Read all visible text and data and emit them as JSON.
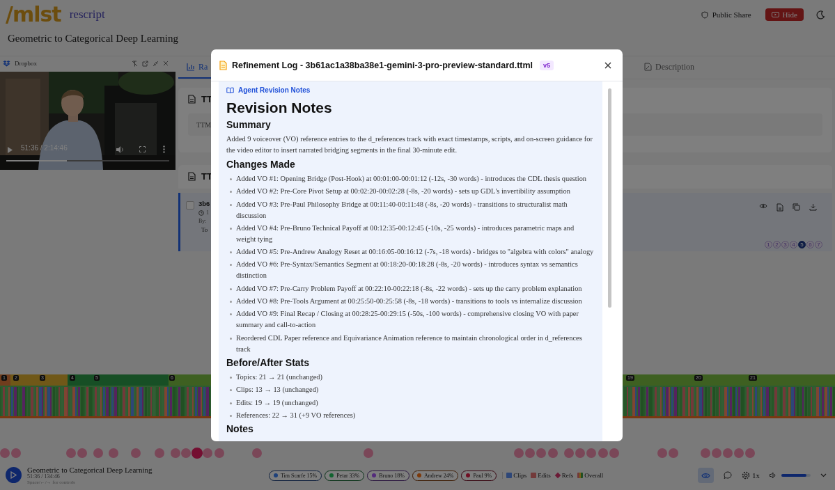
{
  "header": {
    "logo": "/mlst",
    "app": "rescript",
    "share": "Public Share",
    "hide": "Hide"
  },
  "title": "Geometric to Categorical Deep Learning",
  "player": {
    "source": "Dropbox",
    "time": "51:36 / 2:14:46",
    "level": 0.37
  },
  "tabs": [
    {
      "label": "Ra",
      "selected": true
    },
    {
      "label": "Description",
      "selected": false
    }
  ],
  "panel_1": {
    "heading": "TT",
    "text": "TTM"
  },
  "panel_2": {
    "heading": "TT"
  },
  "file_row": {
    "name": "3b6",
    "time": "1",
    "author": "By:",
    "tag": "To",
    "checked": false,
    "pages": [
      {
        "label": "1",
        "selected": false
      },
      {
        "label": "2",
        "selected": false
      },
      {
        "label": "3",
        "selected": false
      },
      {
        "label": "4",
        "selected": false
      },
      {
        "label": "5",
        "selected": true
      },
      {
        "label": "6",
        "selected": false
      },
      {
        "label": "7",
        "selected": false
      }
    ]
  },
  "timeline": {
    "markers": [
      "1",
      "2",
      "3",
      "4",
      "5",
      "6",
      "19",
      "20",
      "21"
    ]
  },
  "modal": {
    "title": "Refinement Log - 3b61ac1a38ba38e1-gemini-3-pro-preview-standard.ttml",
    "badge": "v5",
    "section_label": "Agent Revision Notes",
    "heading": "Revision Notes",
    "blocks": [
      {
        "kind": "h2",
        "text": "Summary"
      },
      {
        "kind": "p",
        "text": "Added 9 voiceover (VO) reference entries to the d_references track with exact timestamps, scripts, and on-screen guidance for the video editor to insert narrated bridging segments in the final 30-minute edit."
      },
      {
        "kind": "h2",
        "text": "Changes Made"
      },
      {
        "kind": "ul",
        "items": [
          "Added VO #1: Opening Bridge (Post-Hook) at 00:01:00-00:01:12 (-12s, -30 words) - introduces the CDL thesis question",
          "Added VO #2: Pre-Core Pivot Setup at 00:02:20-00:02:28 (-8s, -20 words) - sets up GDL's invertibility assumption",
          "Added VO #3: Pre-Paul Philosophy Bridge at 00:11:40-00:11:48 (-8s, -20 words) - transitions to structuralist math discussion",
          "Added VO #4: Pre-Bruno Technical Payoff at 00:12:35-00:12:45 (-10s, -25 words) - introduces parametric maps and weight tying",
          "Added VO #5: Pre-Andrew Analogy Reset at 00:16:05-00:16:12 (-7s, -18 words) - bridges to \"algebra with colors\" analogy",
          "Added VO #6: Pre-Syntax/Semantics Segment at 00:18:20-00:18:28 (-8s, -20 words) - introduces syntax vs semantics distinction",
          "Added VO #7: Pre-Carry Problem Payoff at 00:22:10-00:22:18 (-8s, -22 words) - sets up the carry problem explanation",
          "Added VO #8: Pre-Tools Argument at 00:25:50-00:25:58 (-8s, -18 words) - transitions to tools vs internalize discussion",
          "Added VO #9: Final Recap / Closing at 00:28:25-00:29:15 (-50s, -100 words) - comprehensive closing VO with paper summary and call-to-action",
          "Reordered CDL Paper reference and Equivariance Animation reference to maintain chronological order in d_references track"
        ]
      },
      {
        "kind": "h2",
        "text": "Before/After Stats"
      },
      {
        "kind": "ul",
        "items": [
          "Topics: 21 → 21 (unchanged)",
          "Clips: 13 → 13 (unchanged)",
          "Edits: 19 → 19 (unchanged)",
          "References: 22 → 31 (+9 VO references)"
        ]
      },
      {
        "kind": "h2",
        "text": "Notes"
      }
    ]
  },
  "bottom": {
    "title": "Geometric to Categorical Deep Learning",
    "time": "51:36 / 134:46",
    "hint": "Space/←/→ for controls",
    "speakers": [
      {
        "label": "Tim Scarfe 15%",
        "color": "#1e417b"
      },
      {
        "label": "Petar 33%",
        "color": "#11632f"
      },
      {
        "label": "Bruno 18%",
        "color": "#542b7c"
      },
      {
        "label": "Andrew 24%",
        "color": "#7d3a0b"
      },
      {
        "label": "Paul 9%",
        "color": "#710f24"
      }
    ],
    "legend": [
      {
        "kind": "square",
        "label": "Clips",
        "color": "#2e4778"
      },
      {
        "kind": "square",
        "label": "Edits",
        "color": "#733a3a"
      },
      {
        "kind": "diamond",
        "label": "Refs",
        "color": "#6b1a36"
      },
      {
        "kind": "multi",
        "label": "Overall"
      }
    ],
    "view_on": true,
    "speed": "1x",
    "volume": {
      "level": 0.85
    }
  }
}
